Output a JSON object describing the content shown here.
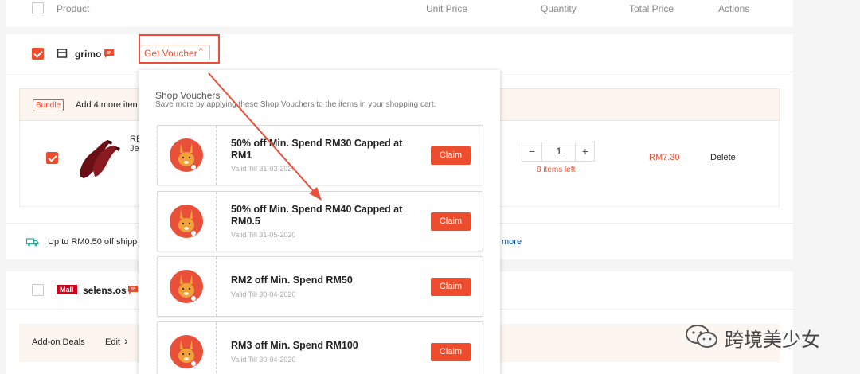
{
  "header": {
    "product": "Product",
    "unit_price": "Unit Price",
    "quantity": "Quantity",
    "total_price": "Total Price",
    "actions": "Actions"
  },
  "shop1": {
    "name": "grimo",
    "voucher_button": "Get Voucher"
  },
  "bundle": {
    "badge": "Bundle",
    "text": "Add 4 more iten"
  },
  "item": {
    "name_partial_1": "RE",
    "name_partial_2": "Je",
    "quantity": "1",
    "stock": "8 items left",
    "total": "RM7.30",
    "delete": "Delete"
  },
  "shipping": {
    "text": "Up to RM0.50 off shipp",
    "more": "more"
  },
  "shop2": {
    "badge": "Mall",
    "name": "selens.os"
  },
  "addon": {
    "label": "Add-on Deals",
    "edit": "Edit"
  },
  "popup": {
    "title": "Shop Vouchers",
    "subtitle": "Save more by applying these Shop Vouchers to the items in your shopping cart.",
    "vouchers": [
      {
        "title": "50% off Min. Spend RM30 Capped at RM1",
        "valid": "Valid Till 31-03-2020",
        "button": "Claim"
      },
      {
        "title": "50% off Min. Spend RM40 Capped at RM0.5",
        "valid": "Valid Till 31-05-2020",
        "button": "Claim"
      },
      {
        "title": "RM2 off Min. Spend RM50",
        "valid": "Valid Till 30-04-2020",
        "button": "Claim"
      },
      {
        "title": "RM3 off Min. Spend RM100",
        "valid": "Valid Till 30-04-2020",
        "button": "Claim"
      }
    ]
  },
  "watermark": {
    "text": "跨境美少女"
  },
  "colors": {
    "accent": "#ee4d2d",
    "annotation": "#e8503a",
    "bundle_bg": "#fdf5ef"
  }
}
